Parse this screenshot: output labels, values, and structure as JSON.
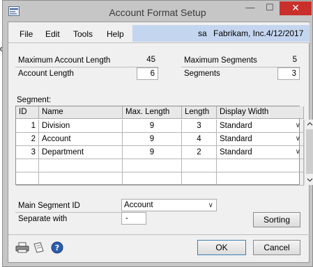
{
  "window": {
    "title": "Account Format Setup",
    "min_glyph": "—",
    "max_glyph": "☐",
    "close_glyph": "✕"
  },
  "menu": [
    "File",
    "Edit",
    "Tools",
    "Help"
  ],
  "context": {
    "user": "sa",
    "company": "Fabrikam, Inc.",
    "date": "4/12/2017"
  },
  "fields": {
    "max_account_length": {
      "label": "Maximum Account Length",
      "value": "45"
    },
    "account_length": {
      "label": "Account Length",
      "value": "6"
    },
    "max_segments": {
      "label": "Maximum Segments",
      "value": "5"
    },
    "segments": {
      "label": "Segments",
      "value": "3"
    }
  },
  "segment": {
    "label": "Segment:",
    "columns": [
      "ID",
      "Name",
      "Max. Length",
      "Length",
      "Display Width"
    ],
    "rows": [
      {
        "id": "1",
        "name": "Division",
        "max_length": "9",
        "length": "3",
        "display_width": "Standard"
      },
      {
        "id": "2",
        "name": "Account",
        "max_length": "9",
        "length": "4",
        "display_width": "Standard"
      },
      {
        "id": "3",
        "name": "Department",
        "max_length": "9",
        "length": "2",
        "display_width": "Standard"
      }
    ]
  },
  "main_segment": {
    "label": "Main Segment ID",
    "value": "Account"
  },
  "separator": {
    "label": "Separate with",
    "value": "-"
  },
  "buttons": {
    "sorting": "Sorting",
    "ok": "OK",
    "cancel": "Cancel"
  },
  "icons": [
    "printer-icon",
    "notes-icon",
    "help-icon",
    "chevron-down-icon"
  ],
  "colors": {
    "menu_band": "#c4d6ef",
    "close_button": "#c9302c",
    "help_icon": "#2a5db0"
  }
}
